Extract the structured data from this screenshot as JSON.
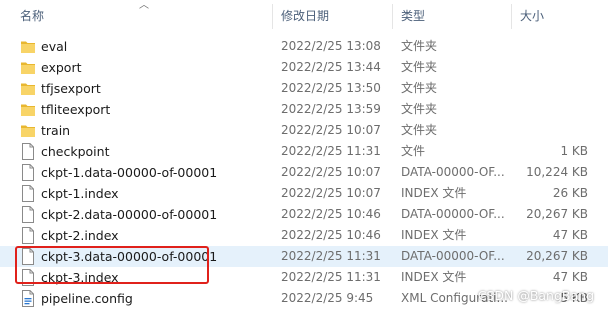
{
  "columns": {
    "name": "名称",
    "date_modified": "修改日期",
    "type": "类型",
    "size": "大小"
  },
  "files": [
    {
      "name": "eval",
      "date": "2022/2/25 13:08",
      "type": "文件夹",
      "size": "",
      "icon": "folder-icon"
    },
    {
      "name": "export",
      "date": "2022/2/25 13:44",
      "type": "文件夹",
      "size": "",
      "icon": "folder-icon"
    },
    {
      "name": "tfjsexport",
      "date": "2022/2/25 13:50",
      "type": "文件夹",
      "size": "",
      "icon": "folder-icon"
    },
    {
      "name": "tfliteexport",
      "date": "2022/2/25 13:59",
      "type": "文件夹",
      "size": "",
      "icon": "folder-icon"
    },
    {
      "name": "train",
      "date": "2022/2/25 10:07",
      "type": "文件夹",
      "size": "",
      "icon": "folder-icon"
    },
    {
      "name": "checkpoint",
      "date": "2022/2/25 11:31",
      "type": "文件",
      "size": "1 KB",
      "icon": "file-icon"
    },
    {
      "name": "ckpt-1.data-00000-of-00001",
      "date": "2022/2/25 10:07",
      "type": "DATA-00000-OF...",
      "size": "10,224 KB",
      "icon": "file-icon"
    },
    {
      "name": "ckpt-1.index",
      "date": "2022/2/25 10:07",
      "type": "INDEX 文件",
      "size": "26 KB",
      "icon": "file-icon"
    },
    {
      "name": "ckpt-2.data-00000-of-00001",
      "date": "2022/2/25 10:46",
      "type": "DATA-00000-OF...",
      "size": "20,267 KB",
      "icon": "file-icon"
    },
    {
      "name": "ckpt-2.index",
      "date": "2022/2/25 10:46",
      "type": "INDEX 文件",
      "size": "47 KB",
      "icon": "file-icon"
    },
    {
      "name": "ckpt-3.data-00000-of-00001",
      "date": "2022/2/25 11:31",
      "type": "DATA-00000-OF...",
      "size": "20,267 KB",
      "icon": "file-icon",
      "selected": true
    },
    {
      "name": "ckpt-3.index",
      "date": "2022/2/25 11:31",
      "type": "INDEX 文件",
      "size": "47 KB",
      "icon": "file-icon"
    },
    {
      "name": "pipeline.config",
      "date": "2022/2/25 9:45",
      "type": "XML Configurati...",
      "size": "5 KB",
      "icon": "config-file-icon"
    }
  ],
  "watermark": "CSDN @BangBang",
  "colors": {
    "folder": "#f4c542",
    "selection": "#e5f1fb",
    "highlight_box": "#e0211b"
  }
}
